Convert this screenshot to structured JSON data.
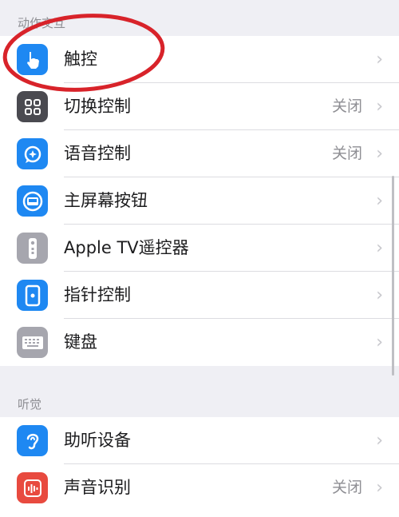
{
  "sections": {
    "motor": "动作交互",
    "hearing": "听觉"
  },
  "motor_items": [
    {
      "label": "触控",
      "value": "",
      "icon": "hand-touch-icon",
      "color": "#1e88f2"
    },
    {
      "label": "切换控制",
      "value": "关闭",
      "icon": "switch-control-grid-icon",
      "color": "#4a4a50"
    },
    {
      "label": "语音控制",
      "value": "关闭",
      "icon": "voice-control-icon",
      "color": "#1e88f2"
    },
    {
      "label": "主屏幕按钮",
      "value": "",
      "icon": "home-button-icon",
      "color": "#1e88f2"
    },
    {
      "label": "Apple TV遥控器",
      "value": "",
      "icon": "tv-remote-icon",
      "color": "#a6a6ae"
    },
    {
      "label": "指针控制",
      "value": "",
      "icon": "pointer-control-icon",
      "color": "#1e88f2"
    },
    {
      "label": "键盘",
      "value": "",
      "icon": "keyboard-icon",
      "color": "#a6a6ae"
    }
  ],
  "hearing_items": [
    {
      "label": "助听设备",
      "value": "",
      "icon": "ear-icon",
      "color": "#1e88f2"
    },
    {
      "label": "声音识别",
      "value": "关闭",
      "icon": "sound-recognition-icon",
      "color": "#e84a3f"
    }
  ],
  "chevron": "›",
  "annotation": {
    "shape": "red-ellipse-circle",
    "color": "#d8232a"
  }
}
